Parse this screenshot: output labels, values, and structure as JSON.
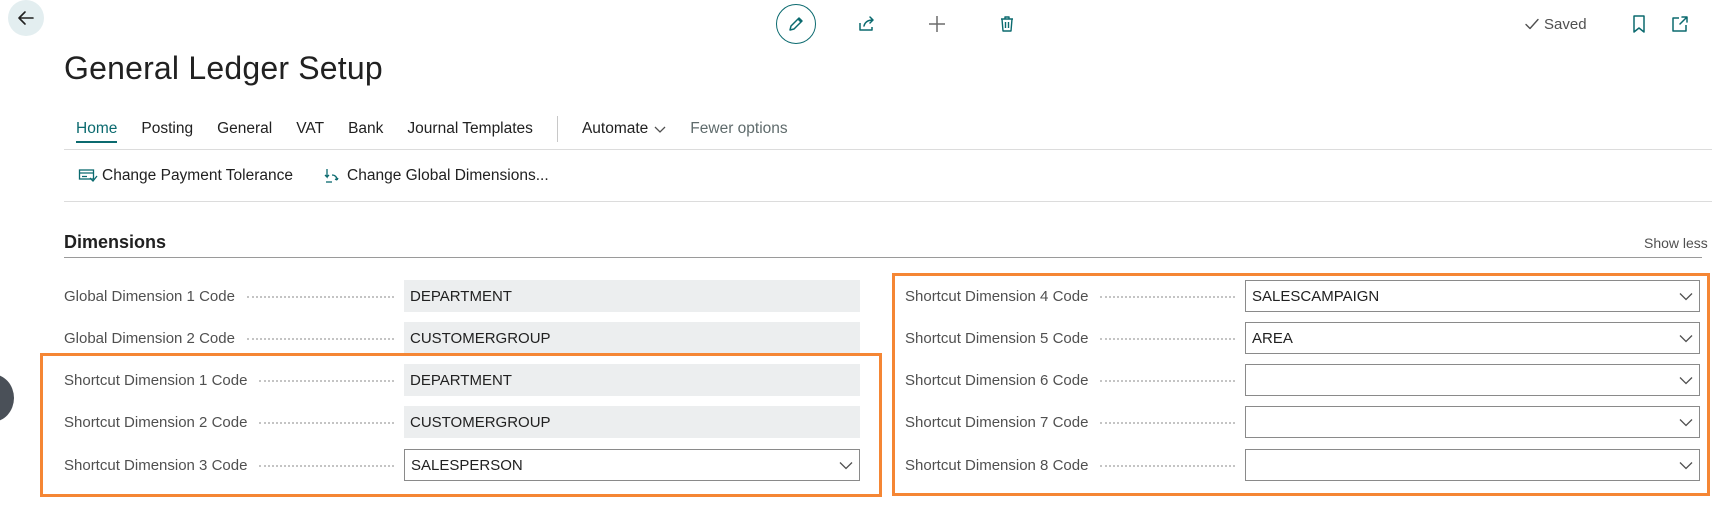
{
  "header": {
    "saved_label": "Saved",
    "icons": [
      "back-arrow-icon",
      "pencil-icon",
      "share-icon",
      "plus-icon",
      "trash-icon",
      "checkmark-icon",
      "bookmark-icon",
      "open-new-window-icon"
    ]
  },
  "page_title": "General Ledger Setup",
  "tabs": [
    {
      "label": "Home",
      "active": true
    },
    {
      "label": "Posting"
    },
    {
      "label": "General"
    },
    {
      "label": "VAT"
    },
    {
      "label": "Bank"
    },
    {
      "label": "Journal Templates"
    }
  ],
  "automate_label": "Automate",
  "fewer_options_label": "Fewer options",
  "actions": {
    "change_payment_tolerance": "Change Payment Tolerance",
    "change_global_dimensions": "Change Global Dimensions..."
  },
  "section": {
    "title": "Dimensions",
    "show_less": "Show less"
  },
  "left_fields": [
    {
      "label": "Global Dimension 1 Code",
      "value": "DEPARTMENT",
      "type": "readonly"
    },
    {
      "label": "Global Dimension 2 Code",
      "value": "CUSTOMERGROUP",
      "type": "readonly"
    },
    {
      "label": "Shortcut Dimension 1 Code",
      "value": "DEPARTMENT",
      "type": "readonly"
    },
    {
      "label": "Shortcut Dimension 2 Code",
      "value": "CUSTOMERGROUP",
      "type": "readonly"
    },
    {
      "label": "Shortcut Dimension 3 Code",
      "value": "SALESPERSON",
      "type": "select"
    }
  ],
  "right_fields": [
    {
      "label": "Shortcut Dimension 4 Code",
      "value": "SALESCAMPAIGN",
      "type": "select"
    },
    {
      "label": "Shortcut Dimension 5 Code",
      "value": "AREA",
      "type": "select"
    },
    {
      "label": "Shortcut Dimension 6 Code",
      "value": "",
      "type": "select"
    },
    {
      "label": "Shortcut Dimension 7 Code",
      "value": "",
      "type": "select"
    },
    {
      "label": "Shortcut Dimension 8 Code",
      "value": "",
      "type": "select"
    }
  ],
  "colors": {
    "accent": "#0b6a6f",
    "highlight": "#f58634",
    "readonly_bg": "#eceeef"
  }
}
